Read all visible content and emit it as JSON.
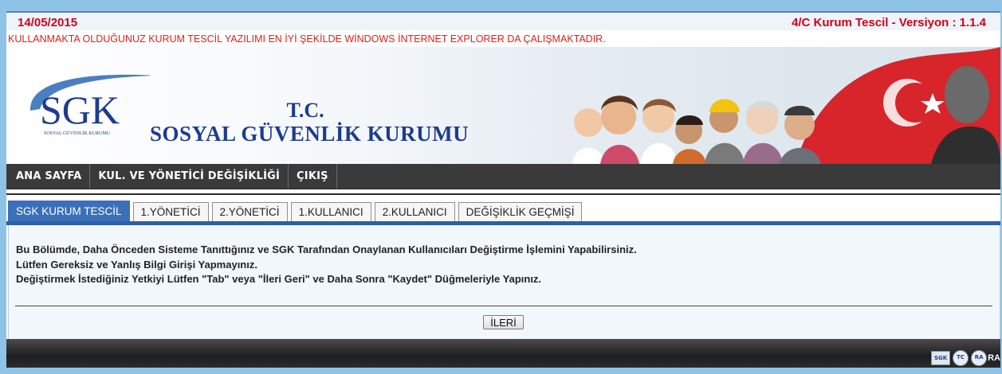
{
  "header": {
    "date": "14/05/2015",
    "version": "4/C Kurum Tescil - Versiyon : 1.1.4",
    "notice": "KULLANMAKTA OLDUĞUNUZ KURUM TESCİL YAZILIMI EN İYİ ŞEKİLDE WİNDOWS İNTERNET EXPLORER DA ÇALIŞMAKTADIR."
  },
  "banner": {
    "logo_text": "SGK",
    "logo_subtext": "SOSYAL GÜVENLİK KURUMU",
    "org_tc": "T.C.",
    "org_name": "SOSYAL GÜVENLİK KURUMU"
  },
  "nav": {
    "items": [
      {
        "label": "ANA SAYFA"
      },
      {
        "label": "KUL. VE YÖNETİCİ DEĞİŞİKLİĞİ"
      },
      {
        "label": "ÇIKIŞ"
      }
    ]
  },
  "tabs": [
    {
      "label": "SGK KURUM TESCİL",
      "active": true
    },
    {
      "label": "1.YÖNETİCİ"
    },
    {
      "label": "2.YÖNETİCİ"
    },
    {
      "label": "1.KULLANICI"
    },
    {
      "label": "2.KULLANICI"
    },
    {
      "label": "DEĞİŞİKLİK GEÇMİŞİ"
    }
  ],
  "content": {
    "lines": [
      "Bu Bölümde, Daha Önceden Sisteme Tanıttığınız ve SGK Tarafından Onaylanan Kullanıcıları Değiştirme İşlemini Yapabilirsiniz.",
      "Lütfen Gereksiz ve Yanlış Bilgi Girişi Yapmayınız.",
      "Değiştirmek İstediğiniz Yetkiyi Lütfen \"Tab\" veya \"İleri Geri\" ve Daha Sonra \"Kaydet\" Düğmeleriyle Yapınız."
    ],
    "next_button": "İLERİ"
  },
  "footer": {
    "icon_1": "SGK",
    "icon_2": "TC",
    "icon_3": "RA",
    "trailing_text": "RA"
  },
  "colors": {
    "accent_red": "#d2001a",
    "nav_bg": "#3a3a3a",
    "tab_active": "#3b6fb9",
    "brand_blue": "#1d3c8f"
  }
}
